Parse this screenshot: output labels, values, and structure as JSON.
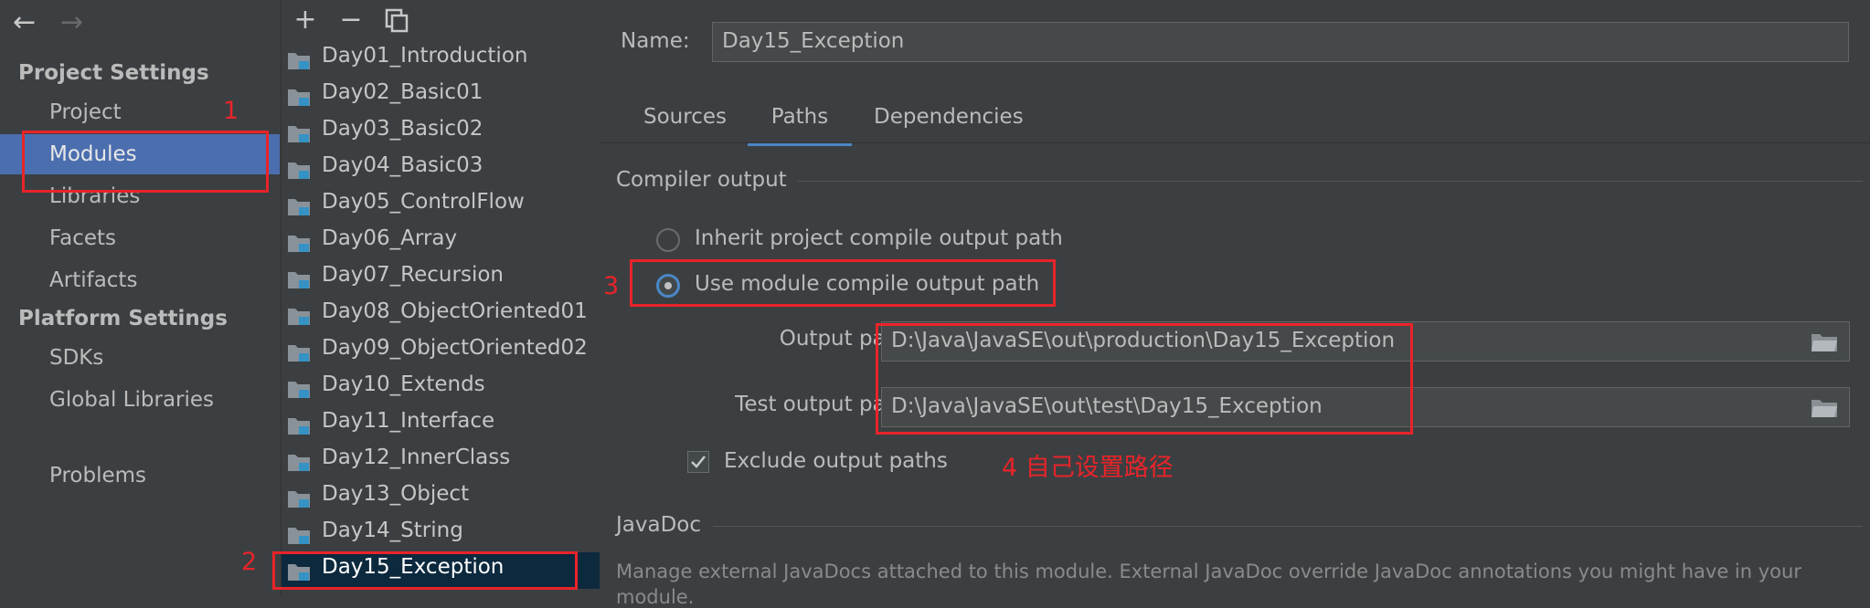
{
  "nav": {
    "project_settings_header": "Project Settings",
    "platform_settings_header": "Platform Settings",
    "items": [
      {
        "label": "Project"
      },
      {
        "label": "Modules"
      },
      {
        "label": "Libraries"
      },
      {
        "label": "Facets"
      },
      {
        "label": "Artifacts"
      },
      {
        "label": "SDKs"
      },
      {
        "label": "Global Libraries"
      },
      {
        "label": "Problems"
      }
    ],
    "selected": "Modules"
  },
  "toolbar": {
    "back_icon": "arrow-left-icon",
    "forward_icon": "arrow-right-icon",
    "add_icon": "plus-icon",
    "remove_icon": "minus-icon",
    "copy_icon": "copy-icon"
  },
  "modules": [
    "Day01_Introduction",
    "Day02_Basic01",
    "Day03_Basic02",
    "Day04_Basic03",
    "Day05_ControlFlow",
    "Day06_Array",
    "Day07_Recursion",
    "Day08_ObjectOriented01",
    "Day09_ObjectOriented02",
    "Day10_Extends",
    "Day11_Interface",
    "Day12_InnerClass",
    "Day13_Object",
    "Day14_String",
    "Day15_Exception"
  ],
  "selected_module": "Day15_Exception",
  "content": {
    "name_label": "Name:",
    "name_value": "Day15_Exception",
    "tabs": [
      "Sources",
      "Paths",
      "Dependencies"
    ],
    "active_tab": "Paths",
    "compiler_output_title": "Compiler output",
    "radio_inherit": "Inherit project compile output path",
    "radio_use_module": "Use module compile output path",
    "selected_radio": "Use module compile output path",
    "output_path_label": "Output path:",
    "output_path_value": "D:\\Java\\JavaSE\\out\\production\\Day15_Exception",
    "test_output_path_label": "Test output path:",
    "test_output_path_value": "D:\\Java\\JavaSE\\out\\test\\Day15_Exception",
    "exclude_label": "Exclude output paths",
    "exclude_checked": true,
    "javadoc_title": "JavaDoc",
    "javadoc_desc": "Manage external JavaDocs attached to this module. External JavaDoc override JavaDoc annotations you might have in your",
    "javadoc_desc_cut": "module."
  },
  "annotations": {
    "step1": "1",
    "step2": "2",
    "step3": "3",
    "step4": "4 自己设置路径",
    "color": "#e8242a"
  },
  "colors": {
    "background": "#3c3f41",
    "selection_blue": "#4b6eaf",
    "list_selection": "#0d293e",
    "accent": "#4a88c7"
  }
}
